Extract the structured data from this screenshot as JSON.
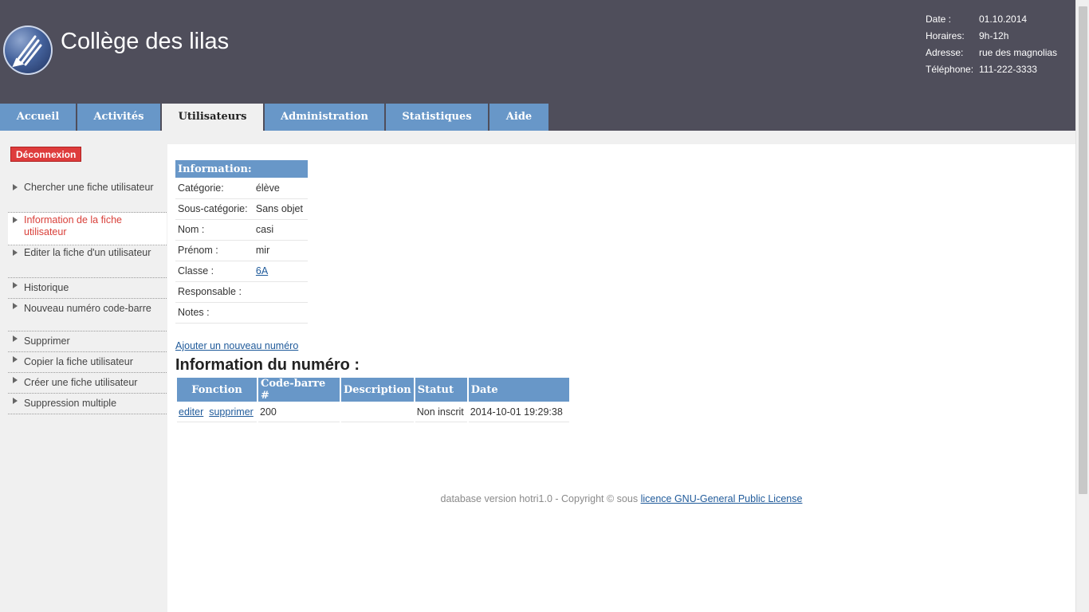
{
  "header": {
    "title": "Collège des lilas",
    "info": [
      {
        "label": "Date :",
        "value": "01.10.2014"
      },
      {
        "label": "Horaires:",
        "value": "9h-12h"
      },
      {
        "label": "Adresse:",
        "value": "rue des magnolias"
      },
      {
        "label": "Téléphone:",
        "value": "111-222-3333"
      }
    ]
  },
  "tabs": [
    {
      "label": "Accueil"
    },
    {
      "label": "Activités"
    },
    {
      "label": "Utilisateurs",
      "active": true
    },
    {
      "label": "Administration"
    },
    {
      "label": "Statistiques"
    },
    {
      "label": "Aide"
    }
  ],
  "sidebar": {
    "logout_label": "Déconnexion",
    "items": [
      {
        "label": "Chercher une fiche utilisateur"
      },
      {
        "label": "Information de la fiche utilisateur",
        "current": true
      },
      {
        "label": "Editer la fiche d'un utilisateur"
      },
      {
        "label": "Historique"
      },
      {
        "label": "Nouveau numéro code-barre"
      },
      {
        "label": "Supprimer"
      },
      {
        "label": "Copier la fiche utilisateur"
      },
      {
        "label": "Créer une fiche utilisateur"
      },
      {
        "label": "Suppression multiple"
      }
    ]
  },
  "info_table": {
    "header": "Information:",
    "rows": [
      {
        "label": "Catégorie:",
        "value": "élève"
      },
      {
        "label": "Sous-catégorie:",
        "value": "Sans objet"
      },
      {
        "label": "Nom :",
        "value": "casi"
      },
      {
        "label": "Prénom :",
        "value": "mir"
      },
      {
        "label": "Classe :",
        "value": "6A"
      },
      {
        "label": "Responsable :",
        "value": ""
      },
      {
        "label": "Notes :",
        "value": ""
      }
    ]
  },
  "add_number_link": "Ajouter un nouveau numéro",
  "number_section": {
    "title": "Information du numéro :",
    "columns": [
      "Fonction",
      "Code-barre #",
      "Description",
      "Statut",
      "Date"
    ],
    "rows": [
      {
        "edit": "editer",
        "delete": "supprimer",
        "barcode": "200",
        "description": "",
        "status": "Non inscrit",
        "date": "2014-10-01 19:29:38"
      }
    ]
  },
  "footer": {
    "text": "database version hotri1.0 - Copyright © sous ",
    "link": "licence GNU-General Public License"
  },
  "colors": {
    "header_bg": "#4f4e5b",
    "tab_bg": "#6897c8",
    "logout_bg": "#de3c3c",
    "current_item": "#d9403a",
    "link": "#1f5a9a"
  }
}
